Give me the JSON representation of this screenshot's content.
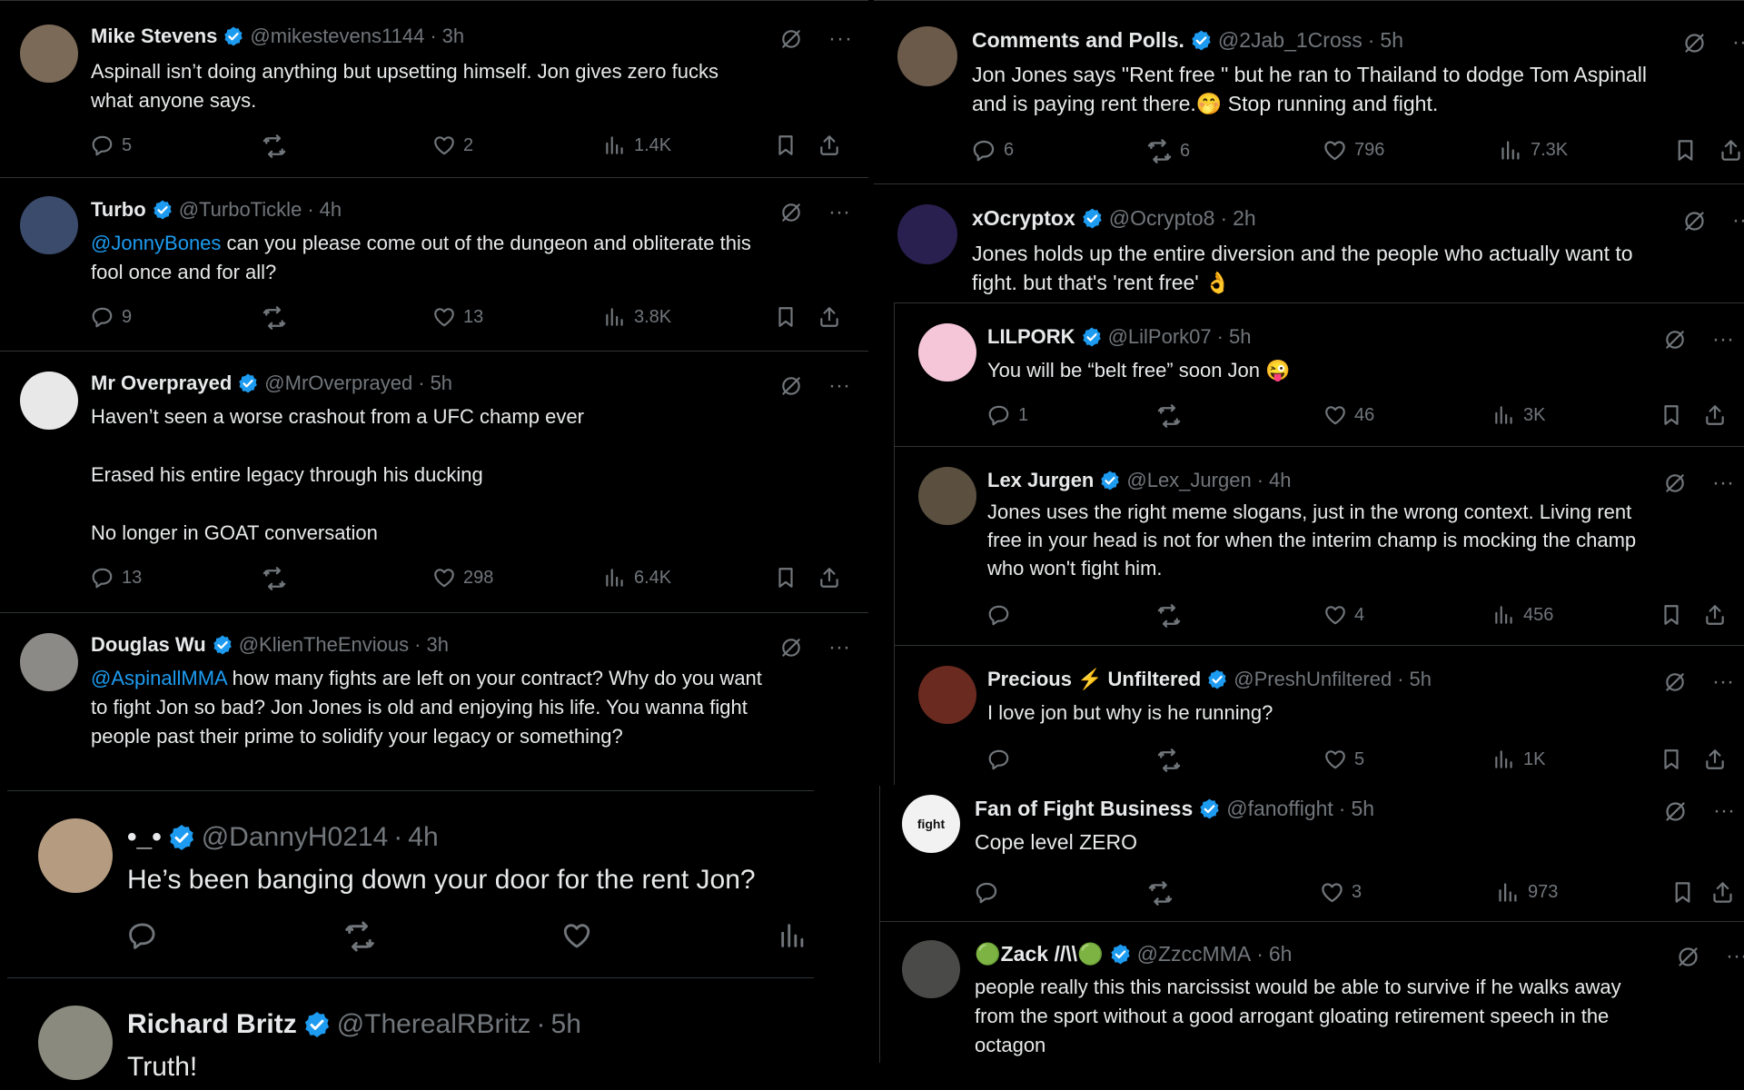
{
  "left_tweets": [
    {
      "name": "Mike Stevens",
      "handle": "@mikestevens1144",
      "time": "3h",
      "text": "Aspinall isn’t doing anything but upsetting himself. Jon gives zero fucks\nwhat anyone says.",
      "replies": "5",
      "reposts": "",
      "likes": "2",
      "views": "1.4K",
      "avatar_color": "#7b6a58"
    },
    {
      "name": "Turbo",
      "handle": "@TurboTickle",
      "time": "4h",
      "mention": "@JonnyBones",
      "text": " can you please come out of the dungeon and obliterate this\nfool once and for all?",
      "replies": "9",
      "reposts": "",
      "likes": "13",
      "views": "3.8K",
      "avatar_color": "#3a4b6b"
    },
    {
      "name": "Mr Overprayed",
      "handle": "@MrOverprayed",
      "time": "5h",
      "text": "Haven’t seen a worse crashout from a UFC champ ever\n\nErased his entire legacy through his ducking\n\nNo longer in GOAT conversation",
      "replies": "13",
      "reposts": "",
      "likes": "298",
      "views": "6.4K",
      "avatar_color": "#e8e8e8"
    },
    {
      "name": "Douglas Wu",
      "handle": "@KlienTheEnvious",
      "time": "3h",
      "mention": "@AspinallMMA",
      "text": " how many fights are left on your contract? Why do you want\nto fight Jon so bad? Jon Jones is old and enjoying his life. You wanna fight\npeople past their prime to solidify your legacy or something?",
      "replies": "",
      "reposts": "",
      "likes": "",
      "views": "",
      "avatar_color": "#8c8a86"
    }
  ],
  "big_tweets": [
    {
      "name": "•_•",
      "handle": "@DannyH0214",
      "time": "4h",
      "text": "He’s been banging down your door for the rent Jon?",
      "avatar_color": "#b59c80"
    },
    {
      "name": "Richard Britz",
      "handle": "@TherealRBritz",
      "time": "5h",
      "text": "Truth!",
      "avatar_color": "#8a8a7e"
    }
  ],
  "right_top_tweets": [
    {
      "name": "Comments and Polls.",
      "handle": "@2Jab_1Cross",
      "time": "5h",
      "text": "Jon Jones says \"Rent free \" but he ran to Thailand to dodge Tom Aspinall\nand is paying rent there.🤭 Stop running and fight.",
      "replies": "6",
      "reposts": "6",
      "likes": "796",
      "views": "7.3K",
      "avatar_color": "#6b5a4a"
    },
    {
      "name": "xOcryptox",
      "handle": "@Ocrypto8",
      "time": "2h",
      "text": "Jones holds up the entire diversion and the people who actually want to\nfight. but that's 'rent free' 👌",
      "avatar_color": "#2a2050"
    }
  ],
  "right_mid_tweets": [
    {
      "name": "LILPORK",
      "handle": "@LilPork07",
      "time": "5h",
      "text": "You will be “belt free” soon Jon 😜",
      "replies": "1",
      "reposts": "",
      "likes": "46",
      "views": "3K",
      "avatar_color": "#f4c6d8"
    },
    {
      "name": "Lex Jurgen",
      "handle": "@Lex_Jurgen",
      "time": "4h",
      "text": "Jones uses the right meme slogans, just in the wrong context. Living rent\nfree in your head is not for when the interim champ is mocking the champ\nwho won't fight him.",
      "replies": "",
      "reposts": "",
      "likes": "4",
      "views": "456",
      "avatar_color": "#5b5040"
    },
    {
      "name": "Precious ⚡ Unfiltered",
      "handle": "@PreshUnfiltered",
      "time": "5h",
      "text": "I love jon but why is he running?",
      "replies": "",
      "reposts": "",
      "likes": "5",
      "views": "1K",
      "avatar_color": "#6b2a20"
    }
  ],
  "right_bottom_tweets": [
    {
      "name": "Fan of Fight Business",
      "handle": "@fanoffight",
      "time": "5h",
      "text": "Cope level ZERO",
      "replies": "",
      "reposts": "",
      "likes": "3",
      "views": "973",
      "avatar_color": "#f2f2f2",
      "avatar_text": "fight"
    },
    {
      "name": "🟢Zack //\\\\🟢",
      "handle": "@ZzccMMA",
      "time": "6h",
      "text": "people really this this narcissist would be able to survive if he walks away\nfrom the sport without a good arrogant gloating retirement speech in the\noctagon",
      "avatar_color": "#4a4a48"
    }
  ],
  "colors": {
    "verified": "#1d9bf0",
    "muted": "#71767b",
    "text": "#e7e9ea",
    "divider": "#2f3336"
  }
}
